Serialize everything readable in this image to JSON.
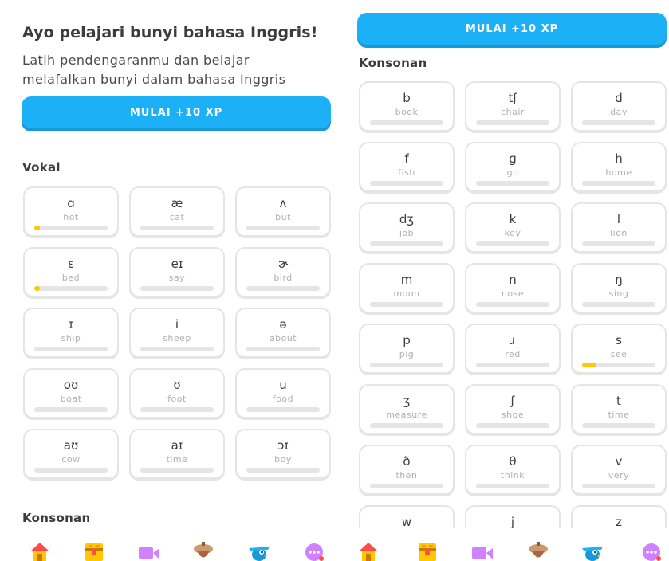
{
  "colors": {
    "accent": "#1cb0f6",
    "progress": "#ffc800",
    "border": "#e5e5e5"
  },
  "left": {
    "title": "Ayo pelajari bunyi bahasa Inggris!",
    "subtitle": "Latih pendengaranmu dan belajar melafalkan bunyi dalam bahasa Inggris",
    "start_label": "MULAI +10 XP",
    "vowel_heading": "Vokal",
    "vowels": [
      {
        "symbol": "ɑ",
        "word": "hot",
        "progress": 0.08
      },
      {
        "symbol": "æ",
        "word": "cat",
        "progress": 0
      },
      {
        "symbol": "ʌ",
        "word": "but",
        "progress": 0
      },
      {
        "symbol": "ɛ",
        "word": "bed",
        "progress": 0.08
      },
      {
        "symbol": "eɪ",
        "word": "say",
        "progress": 0
      },
      {
        "symbol": "ɚ",
        "word": "bird",
        "progress": 0
      },
      {
        "symbol": "ɪ",
        "word": "ship",
        "progress": 0
      },
      {
        "symbol": "i",
        "word": "sheep",
        "progress": 0
      },
      {
        "symbol": "ə",
        "word": "about",
        "progress": 0
      },
      {
        "symbol": "oʊ",
        "word": "boat",
        "progress": 0
      },
      {
        "symbol": "ʊ",
        "word": "foot",
        "progress": 0
      },
      {
        "symbol": "u",
        "word": "food",
        "progress": 0
      },
      {
        "symbol": "aʊ",
        "word": "cow",
        "progress": 0
      },
      {
        "symbol": "aɪ",
        "word": "time",
        "progress": 0
      },
      {
        "symbol": "ɔɪ",
        "word": "boy",
        "progress": 0
      }
    ],
    "consonant_heading": "Konsonan"
  },
  "right": {
    "start_label": "MULAI +10 XP",
    "consonant_heading": "Konsonan",
    "consonants": [
      {
        "symbol": "b",
        "word": "book",
        "progress": 0
      },
      {
        "symbol": "tʃ",
        "word": "chair",
        "progress": 0
      },
      {
        "symbol": "d",
        "word": "day",
        "progress": 0
      },
      {
        "symbol": "f",
        "word": "fish",
        "progress": 0
      },
      {
        "symbol": "g",
        "word": "go",
        "progress": 0
      },
      {
        "symbol": "h",
        "word": "home",
        "progress": 0
      },
      {
        "symbol": "dʒ",
        "word": "job",
        "progress": 0
      },
      {
        "symbol": "k",
        "word": "key",
        "progress": 0
      },
      {
        "symbol": "l",
        "word": "lion",
        "progress": 0
      },
      {
        "symbol": "m",
        "word": "moon",
        "progress": 0
      },
      {
        "symbol": "n",
        "word": "nose",
        "progress": 0
      },
      {
        "symbol": "ŋ",
        "word": "sing",
        "progress": 0
      },
      {
        "symbol": "p",
        "word": "pig",
        "progress": 0
      },
      {
        "symbol": "ɹ",
        "word": "red",
        "progress": 0
      },
      {
        "symbol": "s",
        "word": "see",
        "progress": 0.2
      },
      {
        "symbol": "ʒ",
        "word": "measure",
        "progress": 0
      },
      {
        "symbol": "ʃ",
        "word": "shoe",
        "progress": 0
      },
      {
        "symbol": "t",
        "word": "time",
        "progress": 0
      },
      {
        "symbol": "ð",
        "word": "then",
        "progress": 0
      },
      {
        "symbol": "θ",
        "word": "think",
        "progress": 0
      },
      {
        "symbol": "v",
        "word": "very",
        "progress": 0
      },
      {
        "symbol": "w",
        "word": "",
        "progress": 0
      },
      {
        "symbol": "j",
        "word": "",
        "progress": 0
      },
      {
        "symbol": "z",
        "word": "",
        "progress": 0
      }
    ]
  },
  "nav": [
    {
      "name": "home-icon",
      "color": "#ff4b4b"
    },
    {
      "name": "treasure-chest-icon",
      "color": "#ffc800"
    },
    {
      "name": "video-camera-icon",
      "color": "#ce82ff"
    },
    {
      "name": "acorn-icon",
      "color": "#cd9a6b"
    },
    {
      "name": "bird-icon",
      "color": "#1cb0f6"
    },
    {
      "name": "more-icon",
      "color": "#ce82ff"
    }
  ]
}
